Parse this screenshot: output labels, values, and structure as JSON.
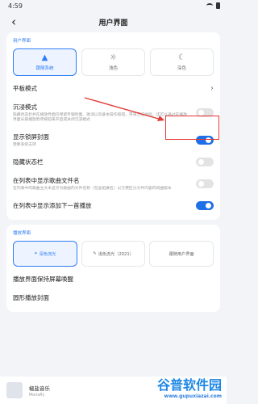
{
  "status": {
    "time": "4:59"
  },
  "header": {
    "title": "用户界面"
  },
  "ui_section": {
    "label": "用户界面",
    "themes": [
      {
        "label": "跟随系统",
        "icon": "android-icon",
        "active": true
      },
      {
        "label": "浅色",
        "icon": "sun-icon",
        "active": false
      },
      {
        "label": "深色",
        "icon": "moon-icon",
        "active": false
      }
    ]
  },
  "settings": {
    "tablet_mode": "平板模式",
    "immersive": {
      "title": "沉浸模式",
      "desc": "隐藏状态栏并在播放界面仅保留专辑封面、歌词以及基本操作按钮，带来沉浸体验。还可以通过在播放界面长按播放暂停按钮来开启或关闭沉浸模式",
      "on": false
    },
    "lock_cover": {
      "title": "显示锁屏封面",
      "desc": "需要系统支持",
      "on": true
    },
    "hide_statusbar": {
      "title": "隐藏状态栏",
      "on": false
    },
    "show_filename": {
      "title": "在列表中显示歌曲文件名",
      "desc": "在列表中的歌曲主文本显示为歌曲的文件名称（包含拓展名）以方便区分文件内容的同曲版本",
      "on": false
    },
    "show_add_next": {
      "title": "在列表中显示添加下一首播放",
      "on": true
    }
  },
  "play_section": {
    "label": "播放界面",
    "themes": [
      {
        "label": "深色流光",
        "active": true
      },
      {
        "label": "浅色流光（2021）",
        "active": false
      },
      {
        "label": "跟随用户界面",
        "active": false
      }
    ],
    "keep_screen": "播放界面保持屏幕唤醒",
    "round_cover": "圆形播放封面"
  },
  "player": {
    "title": "椒盐音乐",
    "subtitle": "Moriafly"
  },
  "watermark": {
    "main": "谷普软件园",
    "sub": "www.gupuxiazai.com"
  }
}
